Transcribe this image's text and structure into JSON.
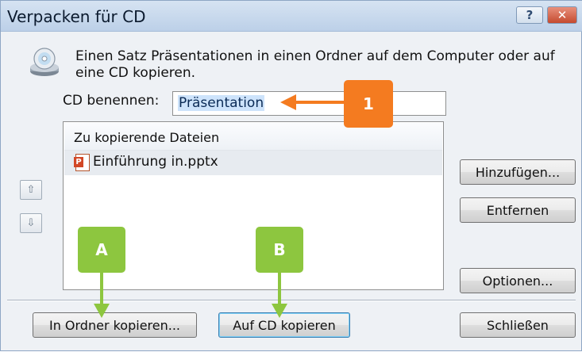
{
  "window": {
    "title": "Verpacken für CD",
    "help_glyph": "?",
    "close_glyph": "✕"
  },
  "description": "Einen Satz Präsentationen in einen Ordner auf dem Computer oder auf eine CD kopieren.",
  "cd_name": {
    "label": "CD benennen:",
    "value": "Präsentation"
  },
  "files": {
    "header": "Zu kopierende Dateien",
    "items": [
      {
        "name": "Einführung in.pptx",
        "icon": "powerpoint-file-icon"
      }
    ]
  },
  "move_up_glyph": "⇧",
  "move_down_glyph": "⇩",
  "buttons": {
    "add": "Hinzufügen...",
    "remove": "Entfernen",
    "options": "Optionen...",
    "copy_folder": "In Ordner kopieren...",
    "copy_cd": "Auf CD kopieren",
    "close": "Schließen"
  },
  "annotations": {
    "callout_1": "1",
    "callout_a": "A",
    "callout_b": "B",
    "callout_1_color": "#f47b20",
    "callout_ab_color": "#8dc63f"
  }
}
